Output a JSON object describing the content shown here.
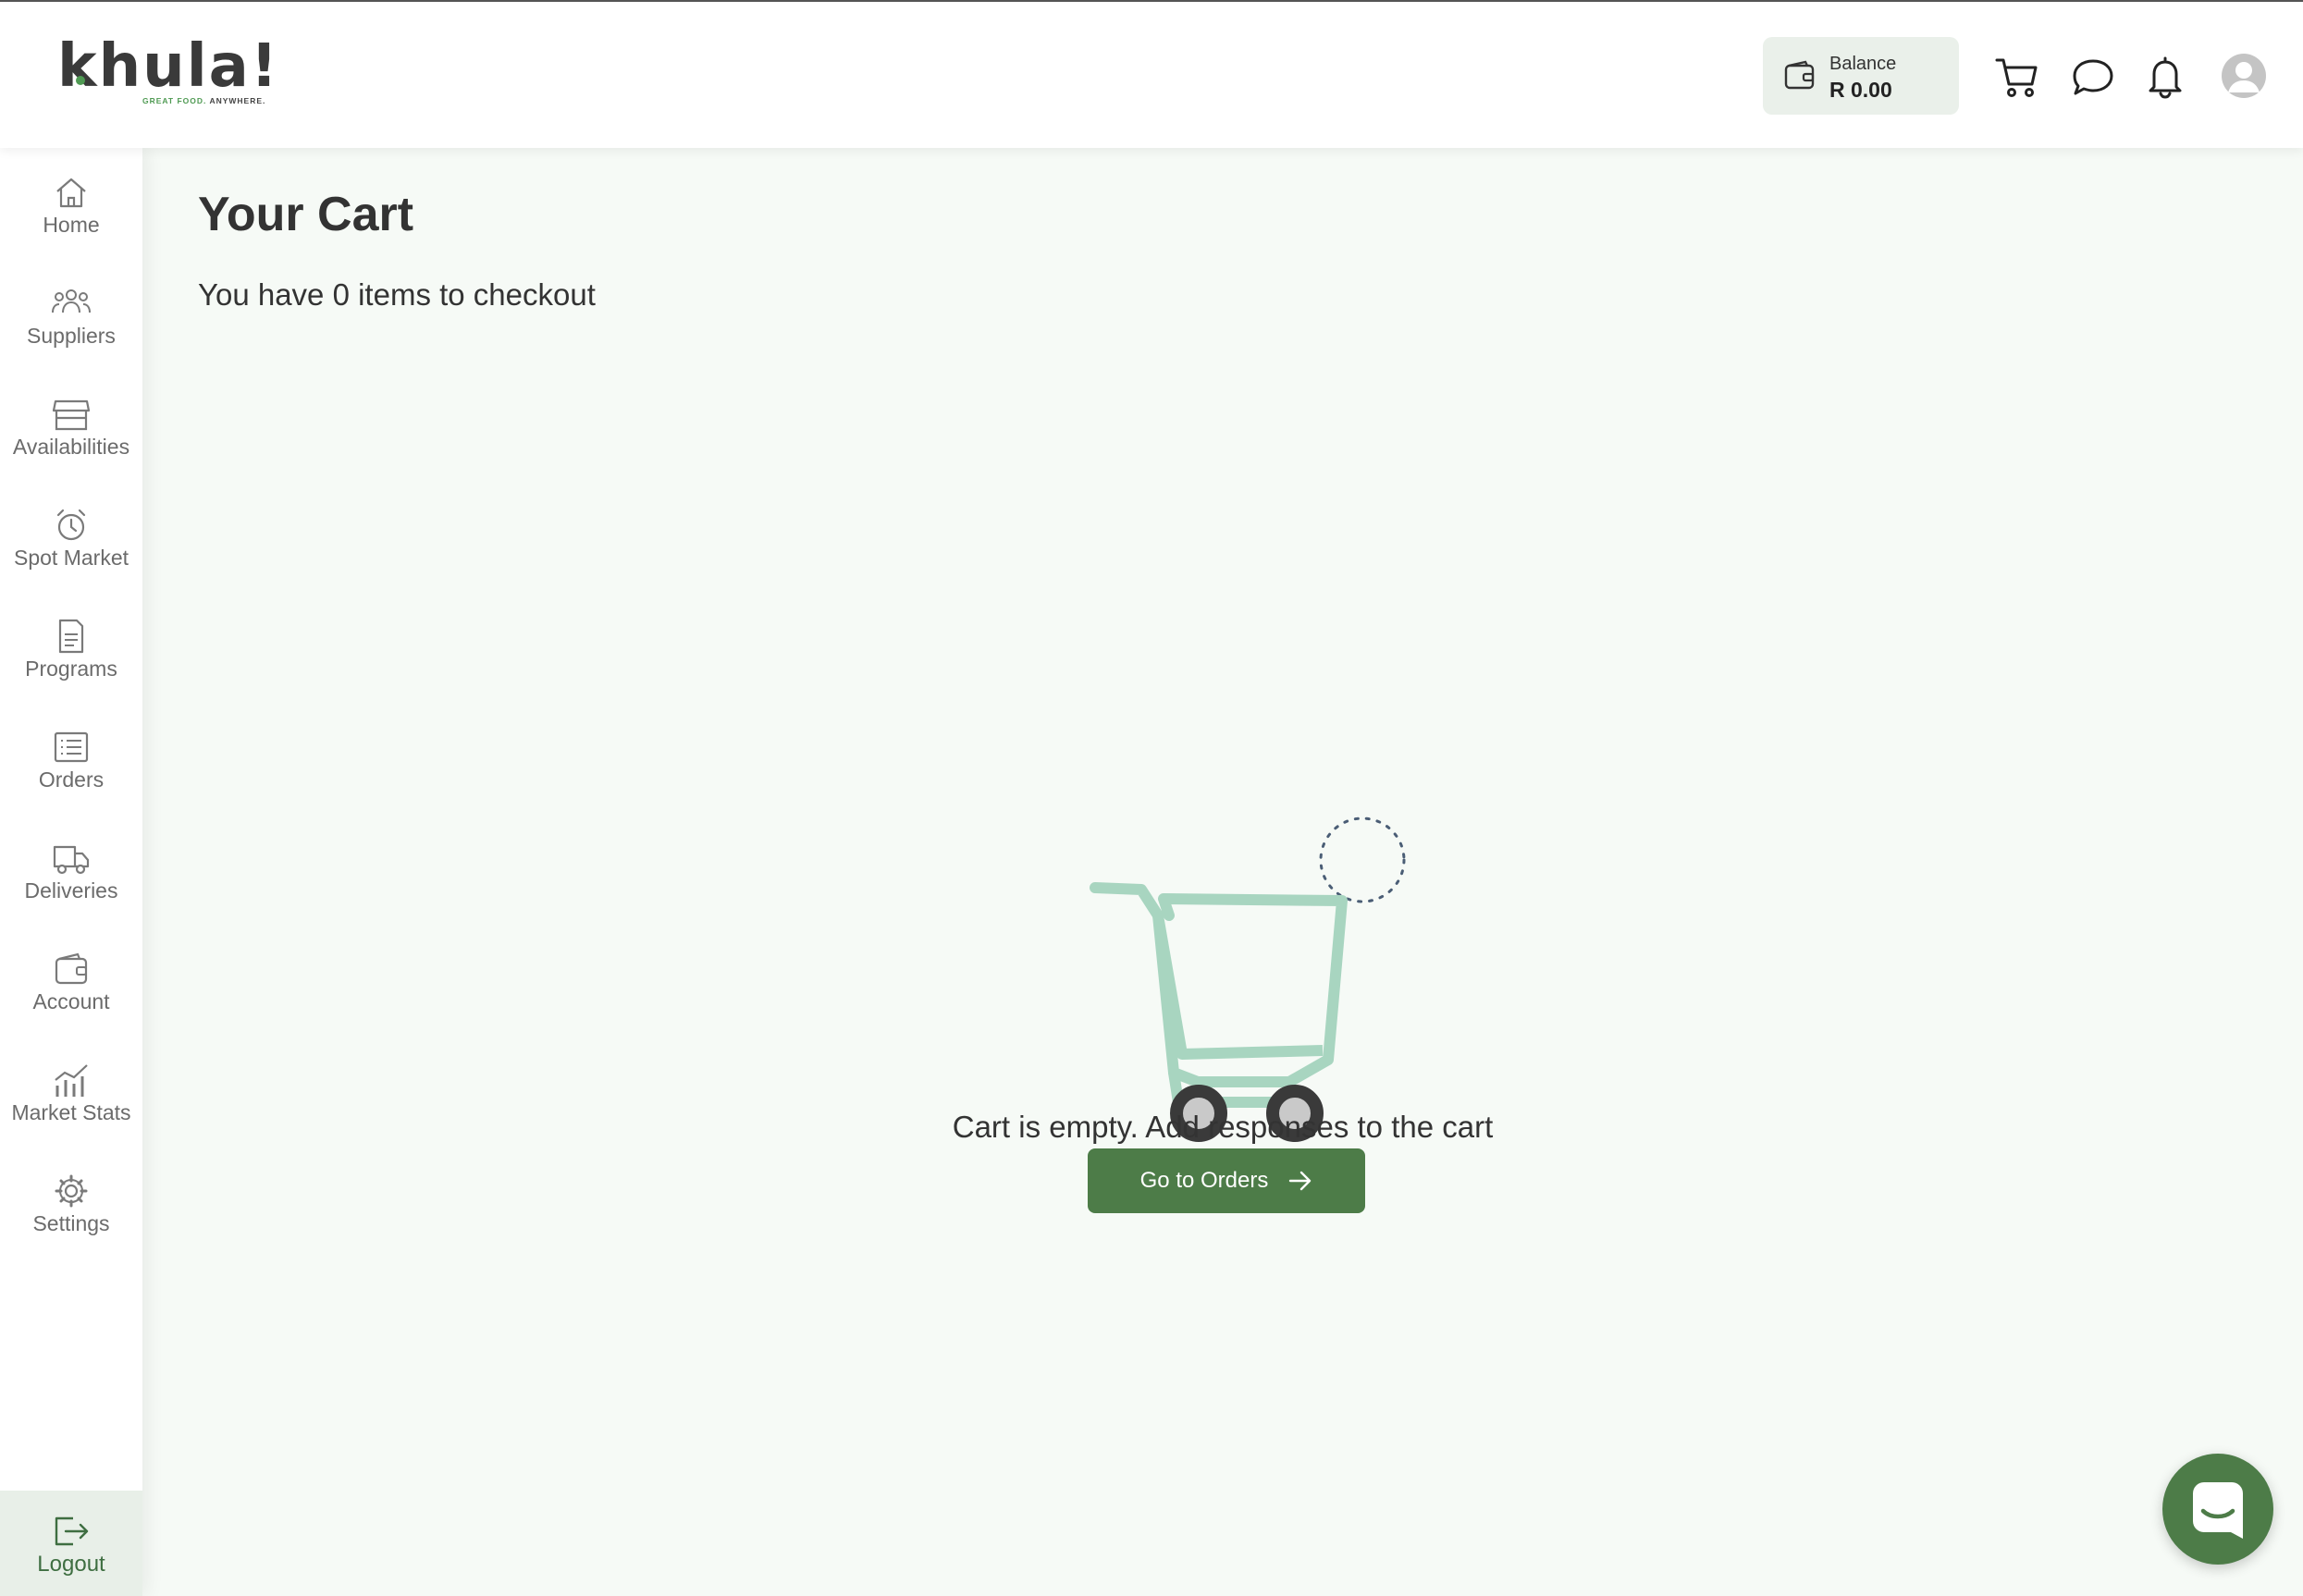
{
  "header": {
    "logo": {
      "word": "khula!",
      "tagline_green": "GREAT FOOD.",
      "tagline_dark": "ANYWHERE."
    },
    "balance": {
      "label": "Balance",
      "value": "R 0.00",
      "icon": "wallet-icon"
    },
    "icons": [
      "cart-icon",
      "chat-icon",
      "bell-icon",
      "avatar-icon"
    ]
  },
  "sidebar": {
    "items": [
      {
        "label": "Home",
        "icon": "home-icon"
      },
      {
        "label": "Suppliers",
        "icon": "users-icon"
      },
      {
        "label": "Availabilities",
        "icon": "store-icon"
      },
      {
        "label": "Spot Market",
        "icon": "alarm-clock-icon"
      },
      {
        "label": "Programs",
        "icon": "document-icon"
      },
      {
        "label": "Orders",
        "icon": "list-icon"
      },
      {
        "label": "Deliveries",
        "icon": "truck-icon"
      },
      {
        "label": "Account",
        "icon": "wallet-icon"
      },
      {
        "label": "Market Stats",
        "icon": "chart-icon"
      },
      {
        "label": "Settings",
        "icon": "gear-icon"
      }
    ],
    "logout": {
      "label": "Logout",
      "icon": "logout-icon"
    }
  },
  "main": {
    "title": "Your Cart",
    "subtitle": "You have 0 items to checkout",
    "empty_message": "Cart is empty. Add responses to the cart",
    "cta_label": "Go to Orders"
  },
  "colors": {
    "brand_green": "#4d7c48",
    "page_background": "#f6faf6",
    "cart_illustration": "#a8d5c0"
  }
}
